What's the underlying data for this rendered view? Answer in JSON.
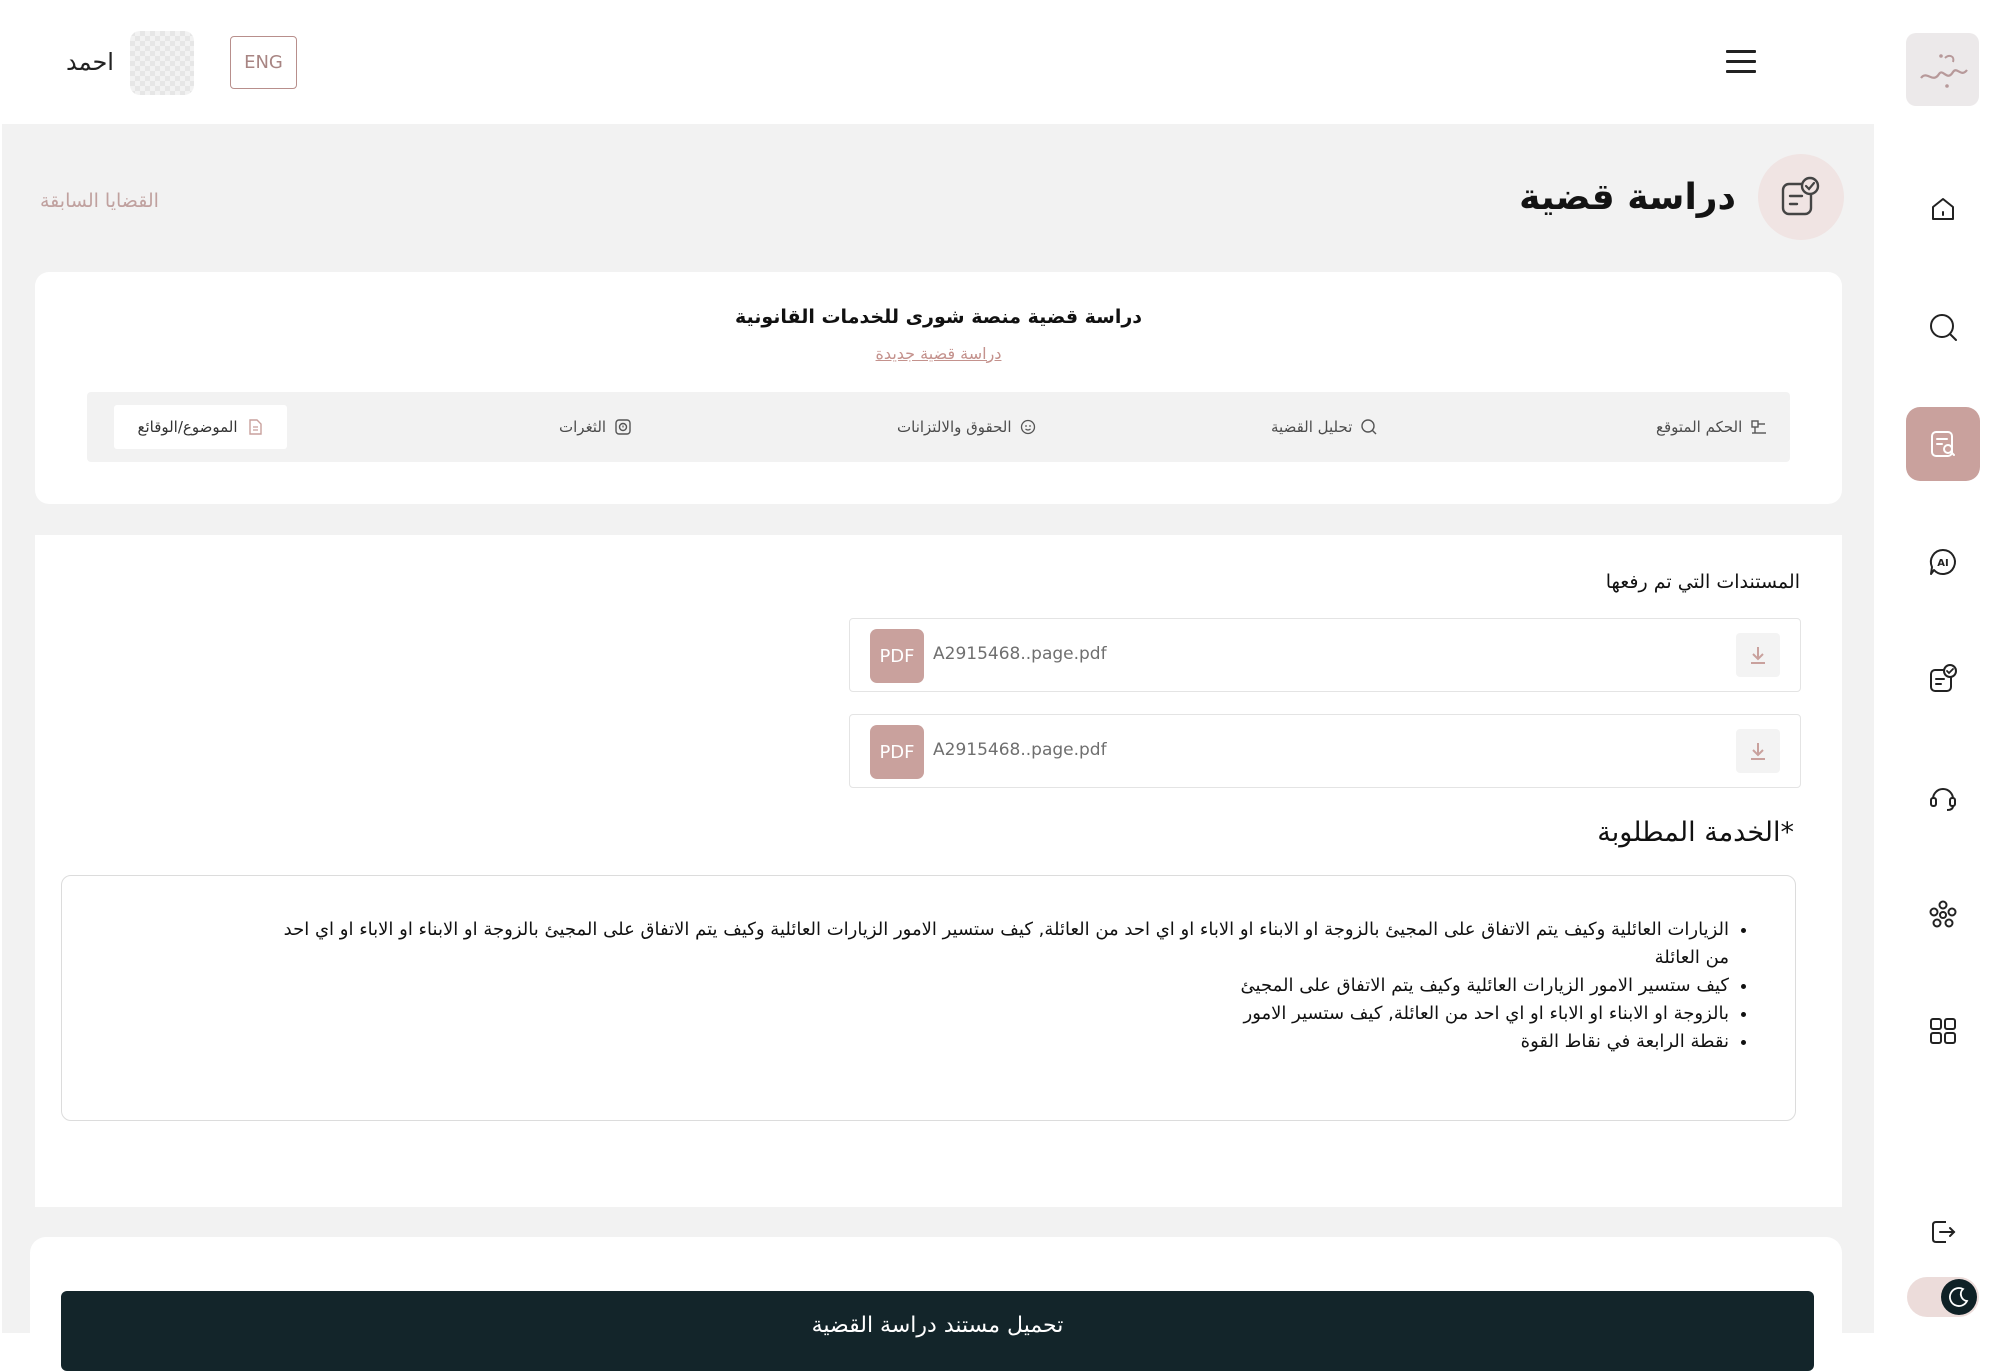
{
  "header": {
    "user_name": "احمد",
    "lang_label": "ENG"
  },
  "page": {
    "title": "دراسة قضية",
    "previous_cases_link": "القضايا السابقة"
  },
  "study_card": {
    "heading": "دراسة قضية منصة شورى للخدمات القانونية",
    "new_case_link": "دراسة قضية جديدة",
    "tabs": [
      {
        "label": "الحكم المتوقع",
        "icon": "judgment-icon"
      },
      {
        "label": "تحليل القضية",
        "icon": "search-icon"
      },
      {
        "label": "الحقوق والالتزانات",
        "icon": "smile-icon"
      },
      {
        "label": "الثغرات",
        "icon": "gap-icon"
      },
      {
        "label": "الموضوع/الوقائع",
        "icon": "document-icon"
      }
    ],
    "active_tab": "الموضوع/الوقائع"
  },
  "documents": {
    "heading": "المستندات التي تم رفعها",
    "files": [
      {
        "badge": "PDF",
        "name": "A2915468..page.pdf"
      },
      {
        "badge": "PDF",
        "name": "A2915468..page.pdf"
      }
    ]
  },
  "service": {
    "heading": "الخدمة المطلوبة*",
    "items": [
      "الزيارات العائلية وكيف يتم الاتفاق على المجيئ بالزوجة او الابناء او الاباء او اي احد من العائلة, كيف ستسير الامور  الزيارات العائلية وكيف يتم الاتفاق على المجيئ بالزوجة او الابناء او الاباء او اي احد من العائلة",
      "كيف ستسير الامور  الزيارات العائلية وكيف يتم الاتفاق على المجيئ",
      "بالزوجة او الابناء او الاباء او اي احد من العائلة, كيف ستسير الامور",
      "نقطة الرابعة في نقاط القوة"
    ]
  },
  "actions": {
    "download_study": "تحميل مستند دراسة القضية"
  },
  "sidebar": {
    "items": [
      {
        "icon": "home-icon"
      },
      {
        "icon": "search-icon"
      },
      {
        "icon": "case-study-icon",
        "active": true
      },
      {
        "icon": "ai-chat-icon"
      },
      {
        "icon": "contract-check-icon"
      },
      {
        "icon": "headset-icon"
      },
      {
        "icon": "community-icon"
      },
      {
        "icon": "grid-icon"
      },
      {
        "icon": "logout-icon"
      }
    ],
    "theme": "dark-mode-toggle"
  },
  "colors": {
    "accent": "#c9a19d",
    "dark_button": "#13252a",
    "link": "#c4928d"
  }
}
